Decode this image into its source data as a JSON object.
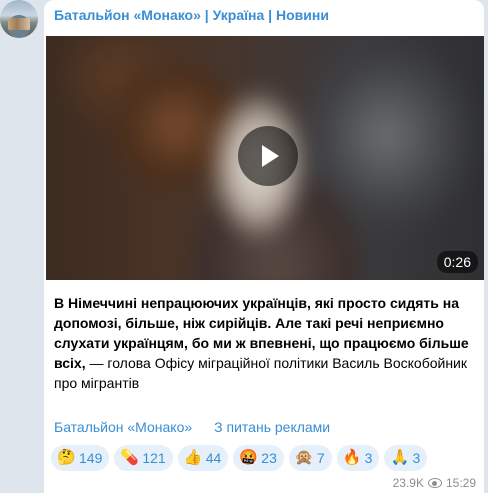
{
  "channel": {
    "title": "Батальйон «Монако» | Україна | Новини"
  },
  "video": {
    "duration": "0:26"
  },
  "message": {
    "text_bold": "В Німеччині непрацюючих українців, які просто сидять на допомозі, більше, ніж сирійців. Але такі речі неприємно слухати українцям, бо ми ж впевнені, що працюємо більше всіх,",
    "text_regular": " — голова Офісу міграційної політики Василь Воскобойник про мігрантів"
  },
  "links": {
    "channel_link": "Батальйон «Монако»",
    "ads_link": "З питань реклами"
  },
  "reactions": [
    {
      "emoji": "🤔",
      "icon": "thinking-face-icon",
      "count": "149"
    },
    {
      "emoji": "💊",
      "icon": "pill-icon",
      "count": "121"
    },
    {
      "emoji": "👍",
      "icon": "thumbs-up-icon",
      "count": "44"
    },
    {
      "emoji": "🤬",
      "icon": "cursing-face-icon",
      "count": "23"
    },
    {
      "emoji": "🙊",
      "icon": "speak-no-evil-monkey-icon",
      "count": "7"
    },
    {
      "emoji": "🔥",
      "icon": "fire-icon",
      "count": "3"
    },
    {
      "emoji": "🙏",
      "icon": "folded-hands-icon",
      "count": "3"
    }
  ],
  "meta": {
    "views": "23.9K",
    "time": "15:29"
  },
  "colors": {
    "accent": "#3a8ed3",
    "reaction_bg": "#e6f0fa",
    "background": "#dfe5ec"
  }
}
